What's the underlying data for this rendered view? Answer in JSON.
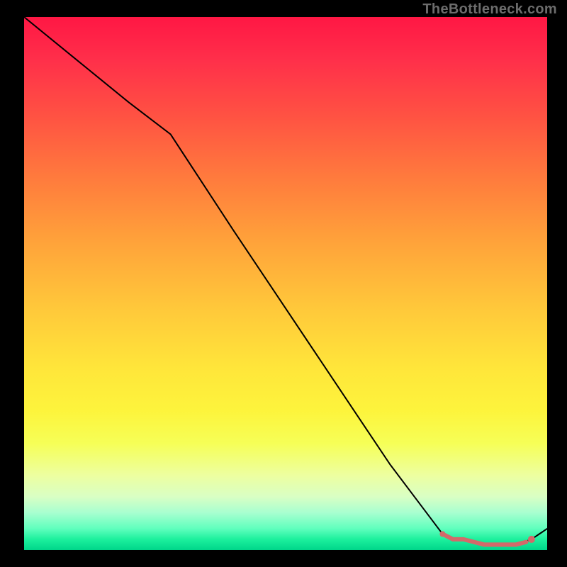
{
  "watermark": "TheBottleneck.com",
  "chart_data": {
    "type": "line",
    "title": "",
    "xlabel": "",
    "ylabel": "",
    "xlim": [
      0,
      100
    ],
    "ylim": [
      0,
      100
    ],
    "grid": false,
    "legend": null,
    "series": [
      {
        "name": "curve",
        "x": [
          0,
          10,
          20,
          28,
          40,
          55,
          70,
          80,
          82,
          84,
          87,
          89,
          92,
          94,
          97,
          100
        ],
        "y": [
          100,
          92,
          84,
          78,
          60,
          38,
          16,
          3,
          2,
          2,
          1,
          1,
          1,
          1,
          2,
          4
        ],
        "color": "#000000",
        "width": 2
      },
      {
        "name": "highlight",
        "x": [
          80,
          82,
          84,
          86,
          88,
          90,
          92,
          94,
          96
        ],
        "y": [
          3,
          2,
          2,
          1.5,
          1,
          1,
          1,
          1,
          1.5
        ],
        "color": "#d26a6a",
        "width": 6
      }
    ],
    "markers": [
      {
        "name": "dot-right",
        "x": 97,
        "y": 2,
        "color": "#d26a6a",
        "r": 5
      },
      {
        "name": "dot-left",
        "x": 80,
        "y": 3,
        "color": "#d26a6a",
        "r": 4
      }
    ],
    "background_gradient": {
      "top": "#ff1744",
      "middle": "#ffe63a",
      "bottom": "#00d68a"
    }
  }
}
